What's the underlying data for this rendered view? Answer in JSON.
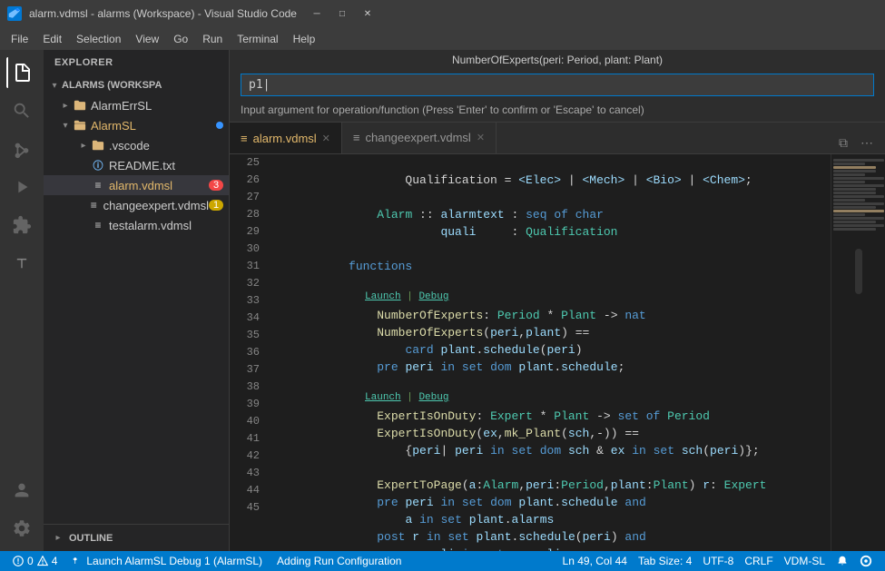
{
  "titleBar": {
    "title": "alarm.vdmsl - alarms (Workspace) - Visual Studio Code"
  },
  "menuBar": {
    "items": [
      "File",
      "Edit",
      "Selection",
      "View",
      "Go",
      "Run",
      "Terminal",
      "Help"
    ]
  },
  "activityBar": {
    "icons": [
      {
        "name": "explorer-icon",
        "symbol": "⎘",
        "active": true
      },
      {
        "name": "search-icon",
        "symbol": "🔍",
        "active": false
      },
      {
        "name": "source-control-icon",
        "symbol": "⎇",
        "active": false
      },
      {
        "name": "run-icon",
        "symbol": "▶",
        "active": false
      },
      {
        "name": "extensions-icon",
        "symbol": "⊞",
        "active": false
      },
      {
        "name": "vdm-icon",
        "symbol": "⊤",
        "active": false
      }
    ],
    "bottomIcons": [
      {
        "name": "accounts-icon",
        "symbol": "👤"
      },
      {
        "name": "settings-icon",
        "symbol": "⚙"
      }
    ]
  },
  "sidebar": {
    "header": "EXPLORER",
    "workspace": "ALARMS (WORKSPA",
    "tree": {
      "alarmErrSL": {
        "label": "AlarmErrSL",
        "collapsed": true
      },
      "alarmSL": {
        "label": "AlarmSL",
        "expanded": true,
        "children": [
          {
            "label": ".vscode",
            "icon": "folder",
            "indent": 2
          },
          {
            "label": "README.txt",
            "icon": "info",
            "indent": 2
          },
          {
            "label": "alarm.vdmsl",
            "icon": "file",
            "indent": 2,
            "badge": "3",
            "badgeType": "error",
            "active": true
          },
          {
            "label": "changeexpert.vdmsl",
            "icon": "file",
            "indent": 2,
            "badge": "1",
            "badgeType": "warning"
          },
          {
            "label": "testalarm.vdmsl",
            "icon": "file",
            "indent": 2
          }
        ]
      }
    },
    "outline": "OUTLINE"
  },
  "inputOverlay": {
    "title": "NumberOfExperts(peri: Period, plant: Plant)",
    "placeholder": "p1|",
    "hint": "Input argument for operation/function (Press 'Enter' to confirm or 'Escape' to cancel)"
  },
  "tabs": [
    {
      "label": "alarm.vdmsl",
      "active": true,
      "icon": "≡"
    },
    {
      "label": "changeexpert.vdmsl",
      "active": false,
      "icon": "≡"
    }
  ],
  "codeLines": [
    {
      "num": "25",
      "content": "        Qualification = <Elec> | <Mech> | <Bio> | <Chem>;",
      "type": "qualification"
    },
    {
      "num": "26",
      "content": "",
      "type": "empty"
    },
    {
      "num": "27",
      "content": "    Alarm :: alarmtext : seq of char",
      "type": "alarm"
    },
    {
      "num": "28",
      "content": "             quali     : Qualification",
      "type": "alarm2"
    },
    {
      "num": "29",
      "content": "",
      "type": "empty"
    },
    {
      "num": "30",
      "content": "functions",
      "type": "functions"
    },
    {
      "num": "31",
      "content": "",
      "type": "empty"
    },
    {
      "num": "32",
      "content": "    NumberOfExperts: Period * Plant -> nat",
      "type": "func-sig"
    },
    {
      "num": "33",
      "content": "    NumberOfExperts(peri,plant) ==",
      "type": "func-body"
    },
    {
      "num": "34",
      "content": "        card plant.schedule(peri)",
      "type": "func-impl"
    },
    {
      "num": "35",
      "content": "    pre peri in set dom plant.schedule;",
      "type": "pre"
    },
    {
      "num": "36",
      "content": "",
      "type": "empty"
    },
    {
      "num": "37",
      "content": "    ExpertIsOnDuty: Expert * Plant -> set of Period",
      "type": "func-sig2"
    },
    {
      "num": "38",
      "content": "    ExpertIsOnDuty(ex,mk_Plant(sch,-)) ==",
      "type": "func-body2"
    },
    {
      "num": "39",
      "content": "        {peri| peri in set dom sch & ex in set sch(peri)};",
      "type": "func-impl2"
    },
    {
      "num": "40",
      "content": "",
      "type": "empty"
    },
    {
      "num": "41",
      "content": "    ExpertToPage(a:Alarm,peri:Period,plant:Plant) r: Expert",
      "type": "func-sig3"
    },
    {
      "num": "42",
      "content": "    pre peri in set dom plant.schedule and",
      "type": "pre2"
    },
    {
      "num": "43",
      "content": "        a in set plant.alarms",
      "type": "pre3"
    },
    {
      "num": "44",
      "content": "    post r in set plant.schedule(peri) and",
      "type": "post"
    },
    {
      "num": "45",
      "content": "        a.quali in set r.quali:",
      "type": "post2"
    }
  ],
  "statusBar": {
    "errors": "0",
    "warnings": "4",
    "debugLabel": "Launch AlarmSL Debug 1 (AlarmSL)",
    "task": "Adding Run Configuration",
    "position": "Ln 49, Col 44",
    "tabSize": "Tab Size: 4",
    "encoding": "UTF-8",
    "lineEnding": "CRLF",
    "language": "VDM-SL"
  },
  "colors": {
    "titleBg": "#3c3c3c",
    "sidebarBg": "#252526",
    "editorBg": "#1e1e1e",
    "statusBg": "#007acc",
    "activeTabBorder": "#007acc",
    "keyword": "#569cd6",
    "function": "#dcdcaa",
    "type": "#4ec9b0",
    "string": "#ce9178",
    "variable": "#9cdcfe"
  }
}
